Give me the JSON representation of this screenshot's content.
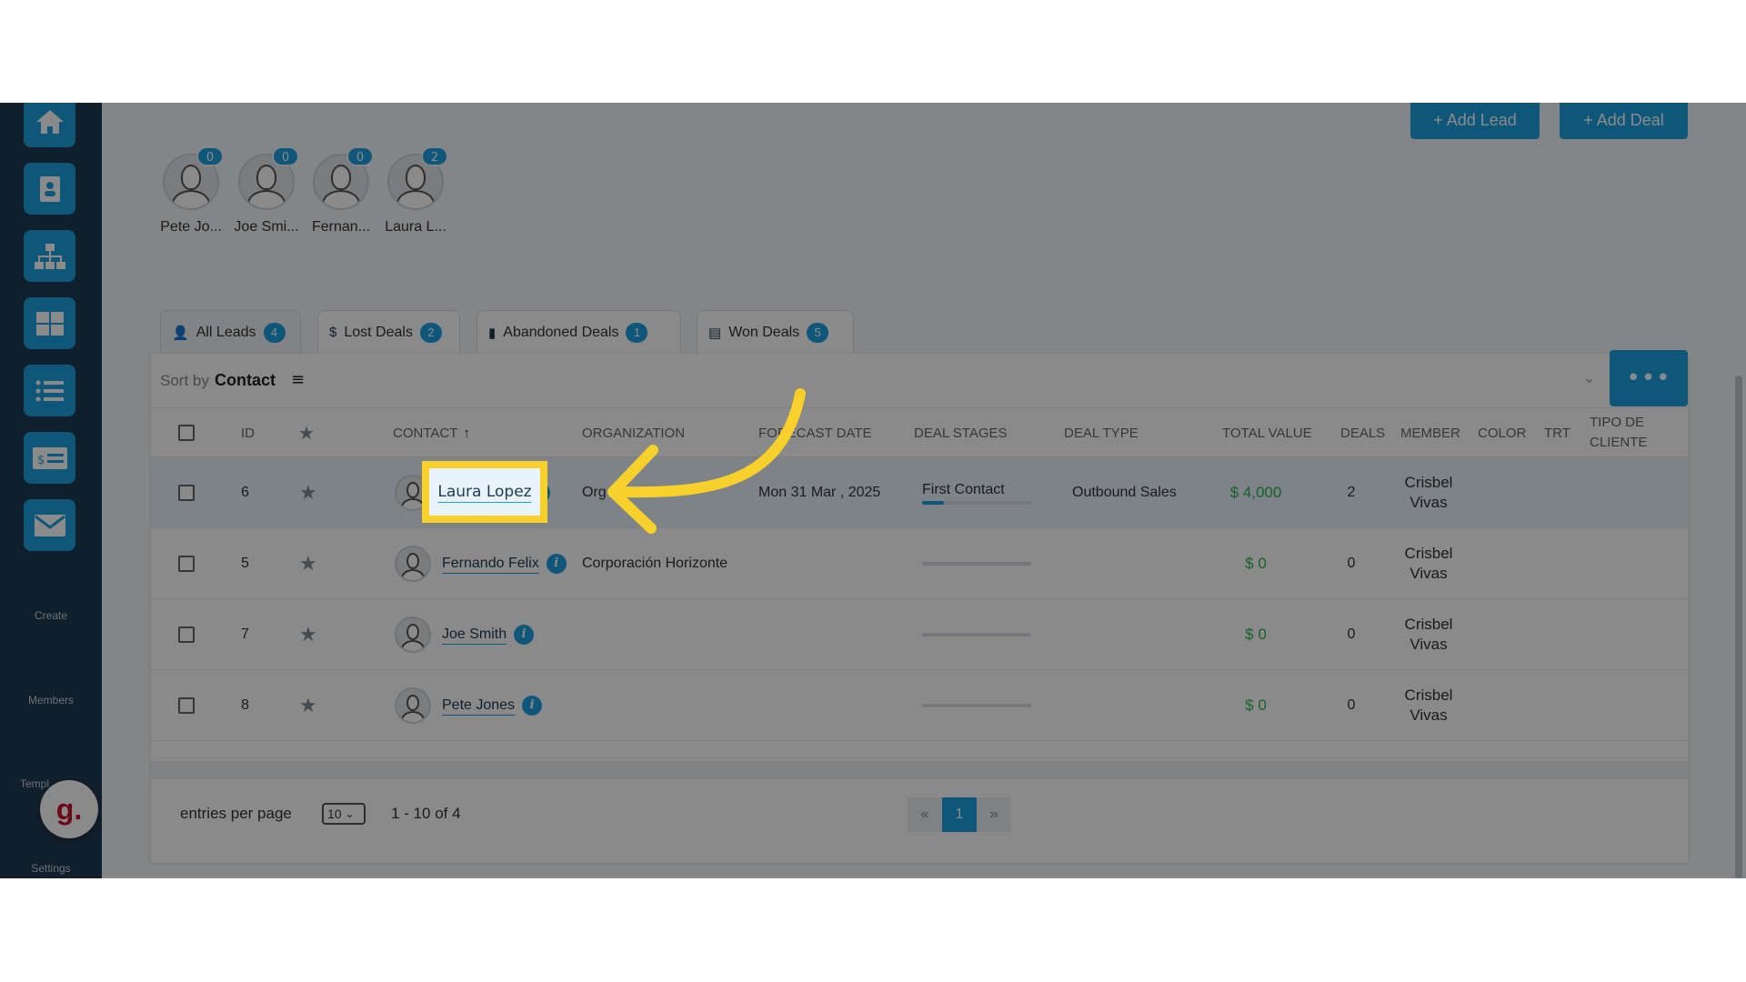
{
  "header": {
    "add_lead_label": "+ Add Lead",
    "add_deal_label": "+ Add Deal"
  },
  "sidebar": {
    "icons": [
      "home-icon",
      "contact-card-icon",
      "org-chart-icon",
      "grid-icon",
      "list-icon",
      "invoice-icon",
      "mail-icon"
    ],
    "labels": {
      "create": "Create",
      "members": "Members",
      "templates": "Templ",
      "settings": "Settings"
    },
    "badge_letter": "g."
  },
  "users": [
    {
      "name": "Pete Jo...",
      "count": "0"
    },
    {
      "name": "Joe Smi...",
      "count": "0"
    },
    {
      "name": "Fernan...",
      "count": "0"
    },
    {
      "name": "Laura L...",
      "count": "2"
    }
  ],
  "tabs": [
    {
      "label": "All Leads",
      "count": "4",
      "icon": "person-icon"
    },
    {
      "label": "Lost Deals",
      "count": "2",
      "icon": "dollar-icon"
    },
    {
      "label": "Abandoned Deals",
      "count": "1",
      "icon": "trash-icon"
    },
    {
      "label": "Won Deals",
      "count": "5",
      "icon": "card-icon"
    }
  ],
  "sort": {
    "prefix": "Sort by",
    "value": "Contact"
  },
  "table": {
    "columns": {
      "id": "ID",
      "contact": "CONTACT",
      "organization": "ORGANIZATION",
      "forecast_date": "FORECAST DATE",
      "deal_stages": "DEAL STAGES",
      "deal_type": "DEAL TYPE",
      "total_value": "TOTAL VALUE",
      "deals": "DEALS",
      "member": "MEMBER",
      "color": "COLOR",
      "trt": "TRT",
      "tipo_line1": "TIPO DE",
      "tipo_line2": "CLIENTE"
    },
    "rows": [
      {
        "id": "6",
        "contact": "Laura Lopez",
        "organization": "Org",
        "forecast_date": "Mon 31 Mar , 2025",
        "deal_stage": "First Contact",
        "stage_progress": 0.2,
        "deal_type": "Outbound Sales",
        "total_value": "$ 4,000",
        "deals": "2",
        "member_line1": "Crisbel",
        "member_line2": "Vivas"
      },
      {
        "id": "5",
        "contact": "Fernando Felix",
        "organization": "Corporación Horizonte",
        "forecast_date": "",
        "deal_stage": "",
        "stage_progress": 0,
        "deal_type": "",
        "total_value": "$ 0",
        "deals": "0",
        "member_line1": "Crisbel",
        "member_line2": "Vivas"
      },
      {
        "id": "7",
        "contact": "Joe Smith",
        "organization": "",
        "forecast_date": "",
        "deal_stage": "",
        "stage_progress": 0,
        "deal_type": "",
        "total_value": "$ 0",
        "deals": "0",
        "member_line1": "Crisbel",
        "member_line2": "Vivas"
      },
      {
        "id": "8",
        "contact": "Pete Jones",
        "organization": "",
        "forecast_date": "",
        "deal_stage": "",
        "stage_progress": 0,
        "deal_type": "",
        "total_value": "$ 0",
        "deals": "0",
        "member_line1": "Crisbel",
        "member_line2": "Vivas"
      }
    ]
  },
  "footer": {
    "entries_label": "entries per page",
    "entries_value": "10",
    "range_text": "1 - 10 of 4",
    "prev": "«",
    "current_page": "1",
    "next": "»"
  },
  "colors": {
    "accent": "#1da1e2",
    "sidebar": "#1f3a52",
    "highlight": "#f7d02c",
    "money": "#2db34a"
  }
}
